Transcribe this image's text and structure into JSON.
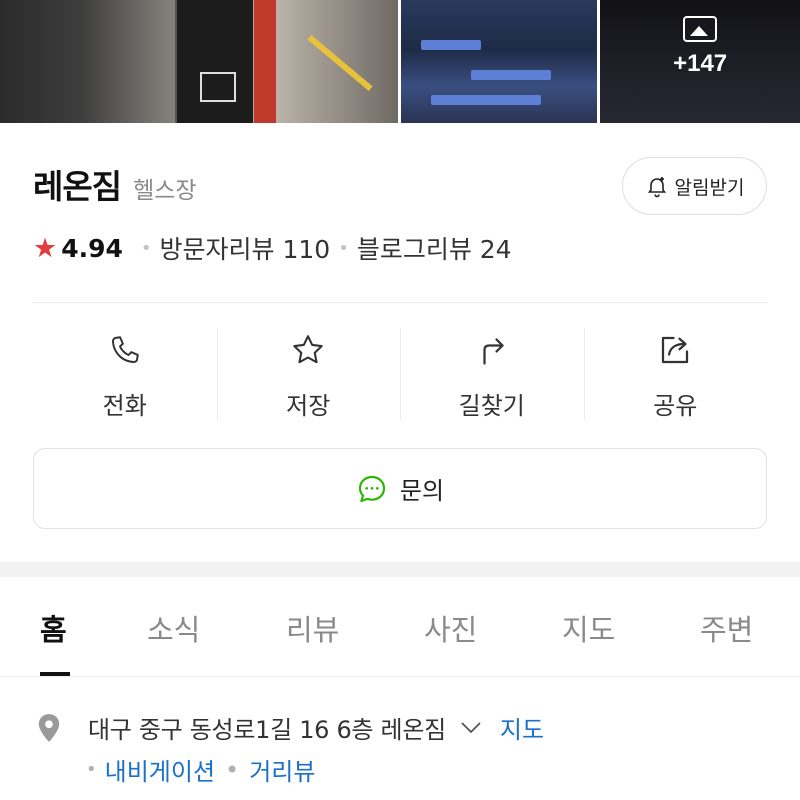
{
  "photos": {
    "more_count": "+147",
    "more_icon": "image-gallery-icon"
  },
  "place": {
    "name": "레온짐",
    "category": "헬스장",
    "alert_label": "알림받기",
    "alert_icon": "bell-plus-icon"
  },
  "rating": {
    "score": "4.94",
    "visitor_reviews": "방문자리뷰 110",
    "blog_reviews": "블로그리뷰 24",
    "star_color": "#e23d3d"
  },
  "actions": [
    {
      "label": "전화",
      "icon": "phone-icon"
    },
    {
      "label": "저장",
      "icon": "star-outline-icon"
    },
    {
      "label": "길찾기",
      "icon": "directions-arrow-icon"
    },
    {
      "label": "공유",
      "icon": "share-icon"
    }
  ],
  "inquiry": {
    "label": "문의",
    "icon": "chat-bubble-icon",
    "icon_color": "#2db400"
  },
  "tabs": [
    {
      "label": "홈",
      "active": true
    },
    {
      "label": "소식"
    },
    {
      "label": "리뷰"
    },
    {
      "label": "사진"
    },
    {
      "label": "지도"
    },
    {
      "label": "주변"
    }
  ],
  "address": {
    "text": "대구 중구 동성로1길 16 6층 레온짐",
    "map_label": "지도",
    "navigation_label": "내비게이션",
    "streetview_label": "거리뷰",
    "link_color": "#1c70c8"
  }
}
